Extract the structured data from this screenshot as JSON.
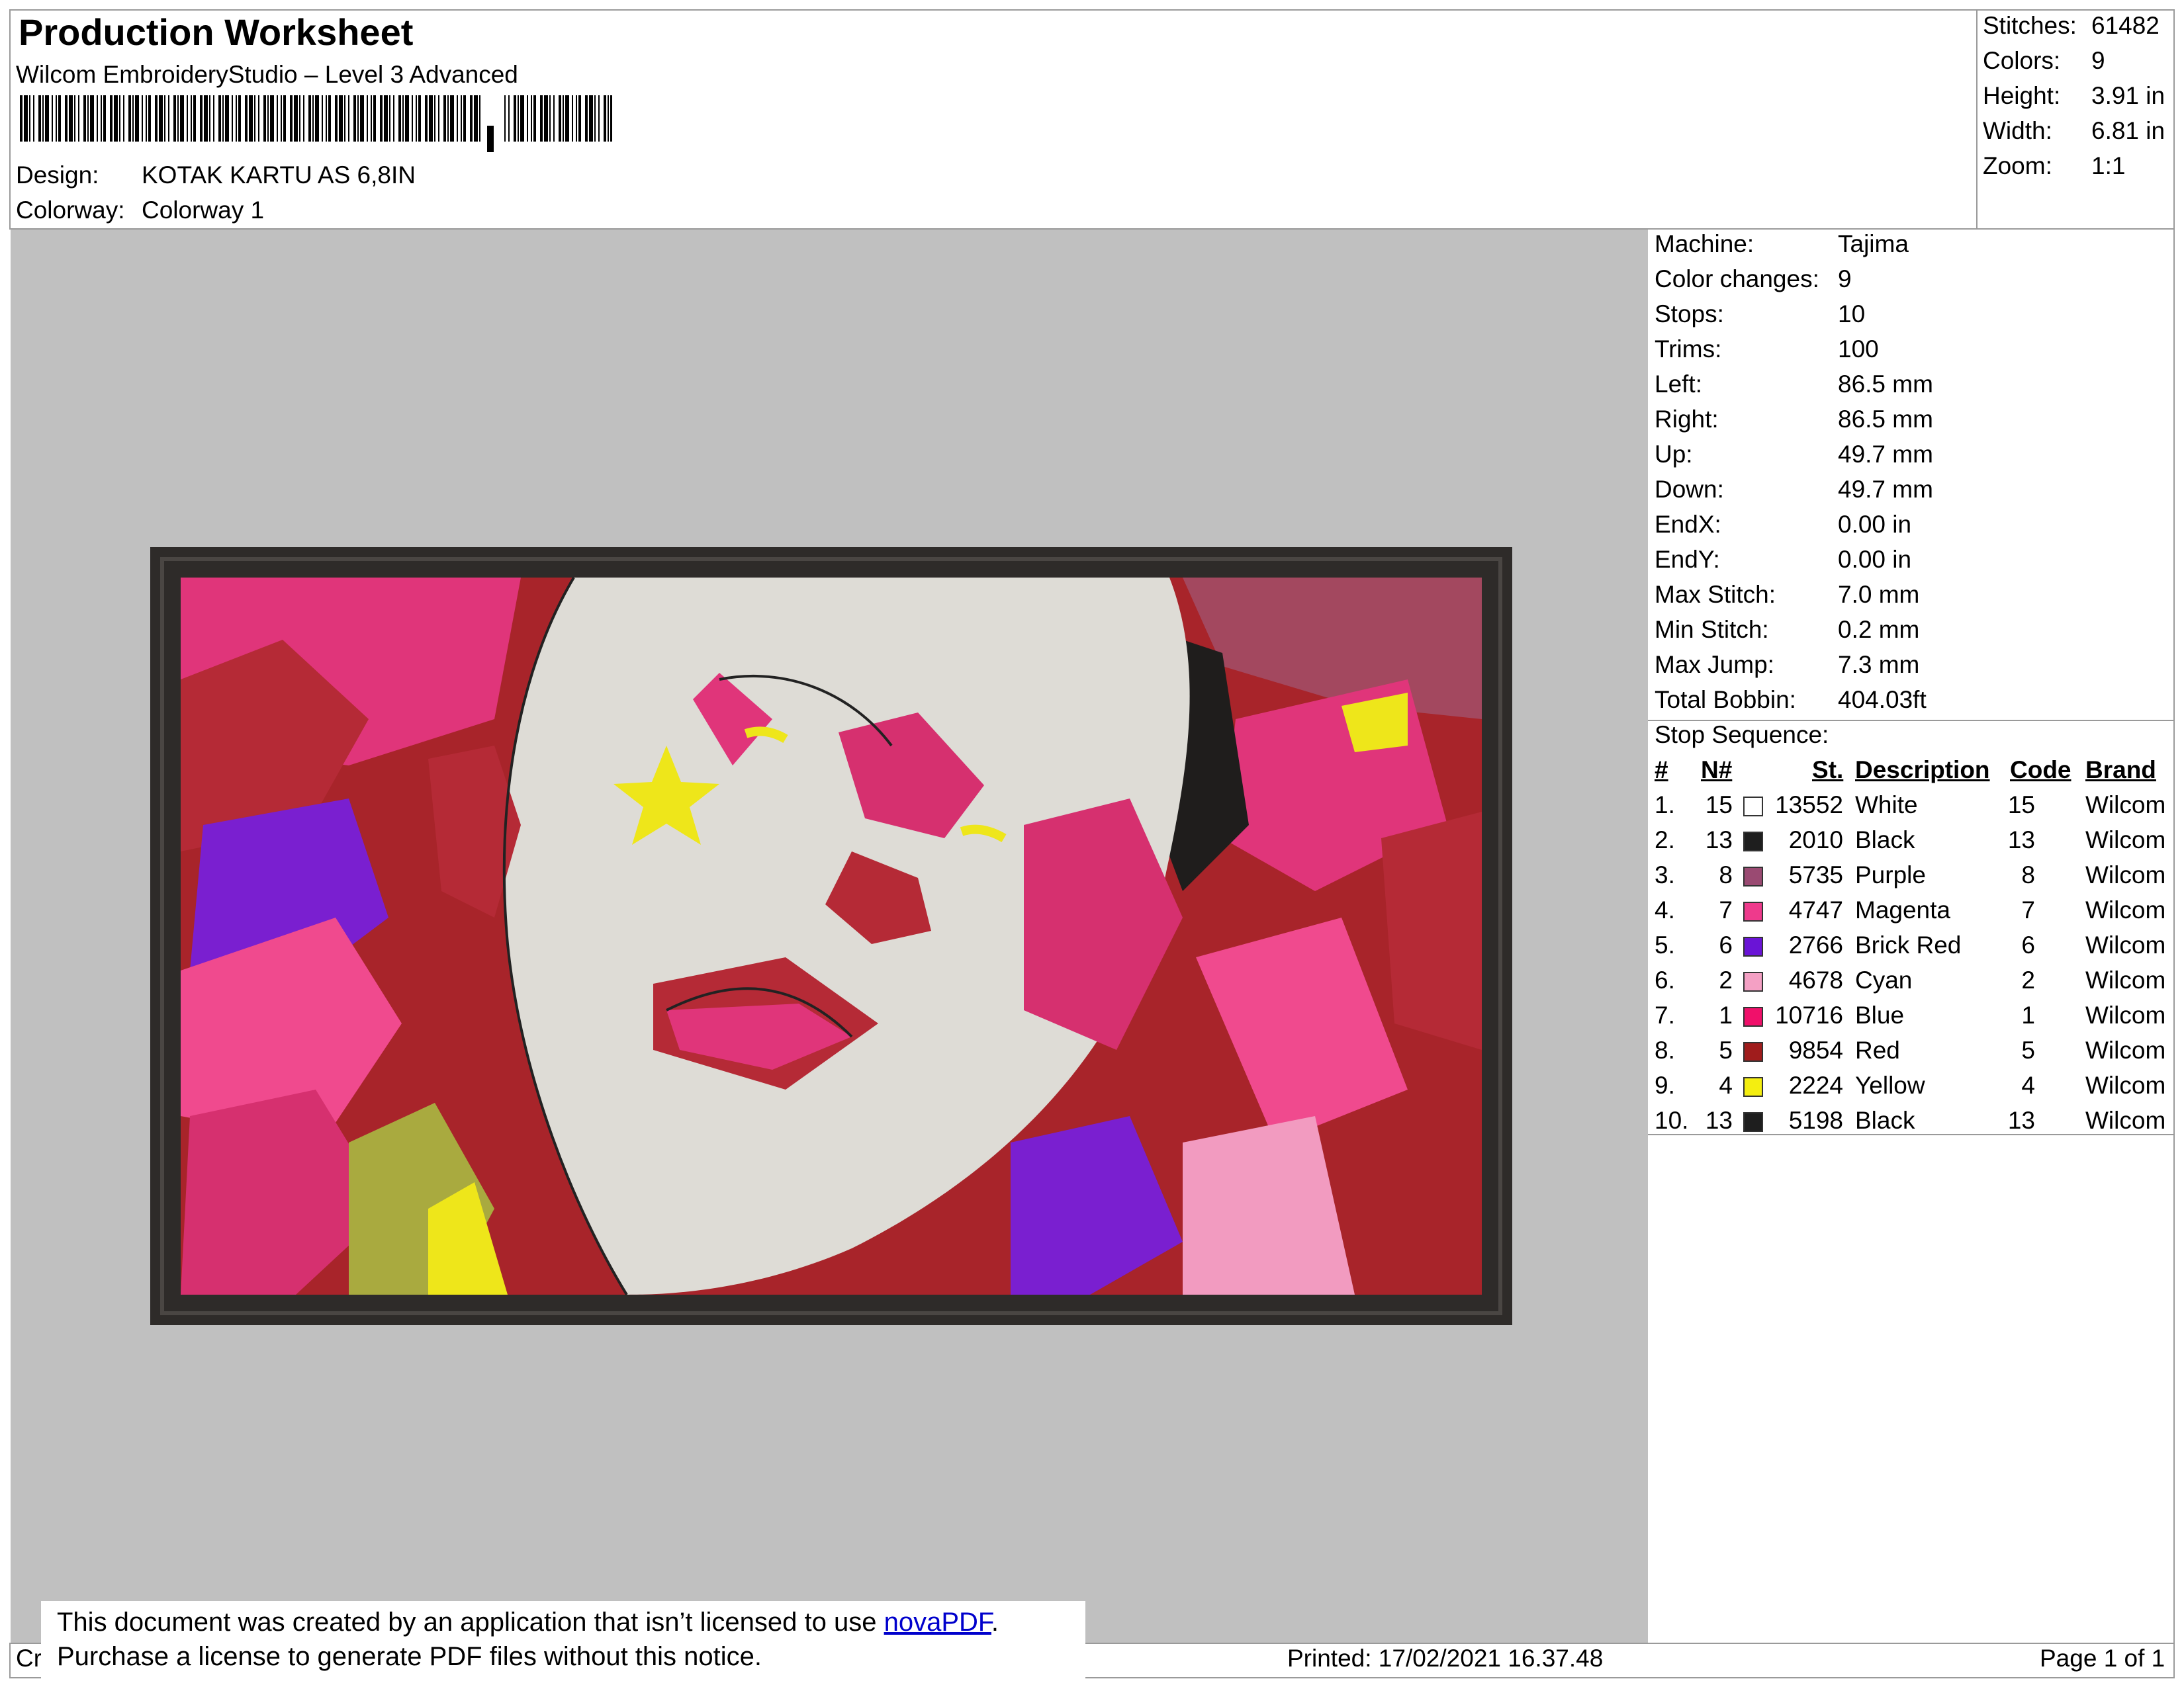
{
  "header": {
    "title": "Production Worksheet",
    "software": "Wilcom EmbroideryStudio – Level 3 Advanced",
    "design_label": "Design:",
    "design_value": "KOTAK KARTU AS 6,8IN",
    "colorway_label": "Colorway:",
    "colorway_value": "Colorway 1"
  },
  "summary": [
    {
      "label": "Stitches:",
      "value": "61482"
    },
    {
      "label": "Colors:",
      "value": "9"
    },
    {
      "label": "Height:",
      "value": "3.91 in"
    },
    {
      "label": "Width:",
      "value": "6.81 in"
    },
    {
      "label": "Zoom:",
      "value": "1:1"
    }
  ],
  "machine_info": [
    {
      "label": "Machine:",
      "value": "Tajima"
    },
    {
      "label": "Color changes:",
      "value": "9"
    },
    {
      "label": "Stops:",
      "value": "10"
    },
    {
      "label": "Trims:",
      "value": "100"
    },
    {
      "label": "Left:",
      "value": "86.5 mm"
    },
    {
      "label": "Right:",
      "value": "86.5 mm"
    },
    {
      "label": "Up:",
      "value": "49.7 mm"
    },
    {
      "label": "Down:",
      "value": "49.7 mm"
    },
    {
      "label": "EndX:",
      "value": "0.00 in"
    },
    {
      "label": "EndY:",
      "value": "0.00 in"
    },
    {
      "label": "Max Stitch:",
      "value": "7.0 mm"
    },
    {
      "label": "Min Stitch:",
      "value": "0.2 mm"
    },
    {
      "label": "Max Jump:",
      "value": "7.3 mm"
    },
    {
      "label": "Total Bobbin:",
      "value": "404.03ft"
    }
  ],
  "stop_sequence": {
    "title": "Stop Sequence:",
    "headers": [
      "#",
      "N#",
      "St.",
      "Description",
      "Code",
      "Brand"
    ],
    "rows": [
      {
        "idx": "1.",
        "n": "15",
        "color": "#ffffff",
        "st": "13552",
        "desc": "White",
        "code": "15",
        "brand": "Wilcom"
      },
      {
        "idx": "2.",
        "n": "13",
        "color": "#1e1e1e",
        "st": "2010",
        "desc": "Black",
        "code": "13",
        "brand": "Wilcom"
      },
      {
        "idx": "3.",
        "n": "8",
        "color": "#9a4a72",
        "st": "5735",
        "desc": "Purple",
        "code": "8",
        "brand": "Wilcom"
      },
      {
        "idx": "4.",
        "n": "7",
        "color": "#ee3a8c",
        "st": "4747",
        "desc": "Magenta",
        "code": "7",
        "brand": "Wilcom"
      },
      {
        "idx": "5.",
        "n": "6",
        "color": "#6a14d6",
        "st": "2766",
        "desc": "Brick Red",
        "code": "6",
        "brand": "Wilcom"
      },
      {
        "idx": "6.",
        "n": "2",
        "color": "#f4a0c4",
        "st": "4678",
        "desc": "Cyan",
        "code": "2",
        "brand": "Wilcom"
      },
      {
        "idx": "7.",
        "n": "1",
        "color": "#f0106a",
        "st": "10716",
        "desc": "Blue",
        "code": "1",
        "brand": "Wilcom"
      },
      {
        "idx": "8.",
        "n": "5",
        "color": "#a01c1c",
        "st": "9854",
        "desc": "Red",
        "code": "5",
        "brand": "Wilcom"
      },
      {
        "idx": "9.",
        "n": "4",
        "color": "#f4ee10",
        "st": "2224",
        "desc": "Yellow",
        "code": "4",
        "brand": "Wilcom"
      },
      {
        "idx": "10.",
        "n": "13",
        "color": "#1e1e1e",
        "st": "5198",
        "desc": "Black",
        "code": "13",
        "brand": "Wilcom"
      }
    ]
  },
  "footer": {
    "left": "Cr",
    "printed": "Printed: 17/02/2021 16.37.48",
    "page": "Page 1 of 1"
  },
  "notice": {
    "line1_prefix": "This document was created by an application that isn’t licensed to use ",
    "link": "novaPDF",
    "line1_suffix": ".",
    "line2": "Purchase a license to generate PDF files without this notice."
  }
}
